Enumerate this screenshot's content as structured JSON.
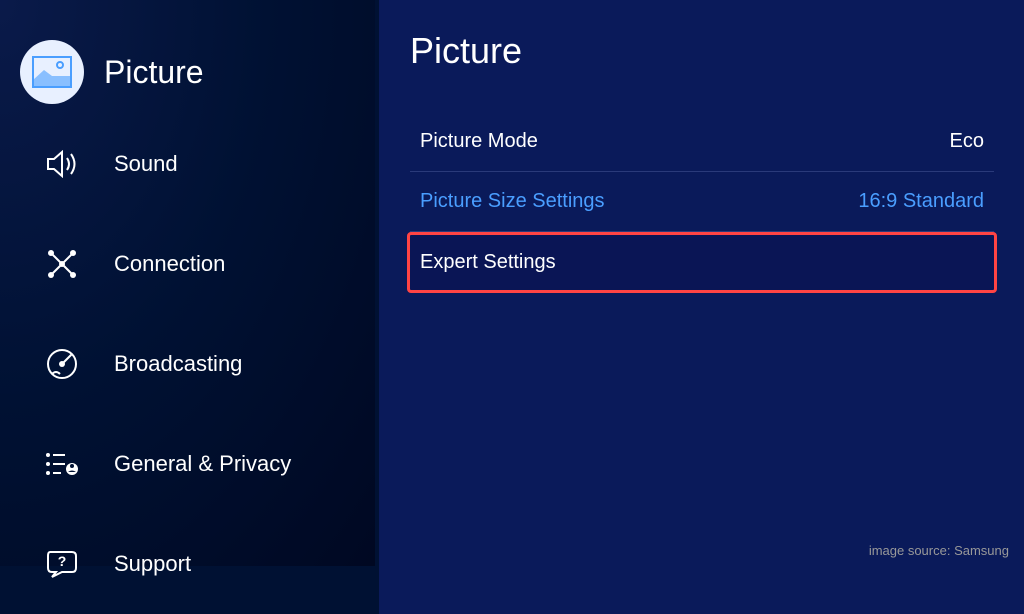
{
  "sidebar": {
    "items": [
      {
        "label": "Picture",
        "icon": "picture-icon",
        "active": true
      },
      {
        "label": "Sound",
        "icon": "sound-icon",
        "active": false
      },
      {
        "label": "Connection",
        "icon": "connection-icon",
        "active": false
      },
      {
        "label": "Broadcasting",
        "icon": "broadcasting-icon",
        "active": false
      },
      {
        "label": "General & Privacy",
        "icon": "general-privacy-icon",
        "active": false
      },
      {
        "label": "Support",
        "icon": "support-icon",
        "active": false
      }
    ]
  },
  "main": {
    "title": "Picture",
    "settings": [
      {
        "label": "Picture Mode",
        "value": "Eco",
        "highlighted": false,
        "selected": false
      },
      {
        "label": "Picture Size Settings",
        "value": "16:9 Standard",
        "highlighted": true,
        "selected": false
      },
      {
        "label": "Expert Settings",
        "value": "",
        "highlighted": false,
        "selected": true
      }
    ]
  },
  "attribution": "image source: Samsung"
}
